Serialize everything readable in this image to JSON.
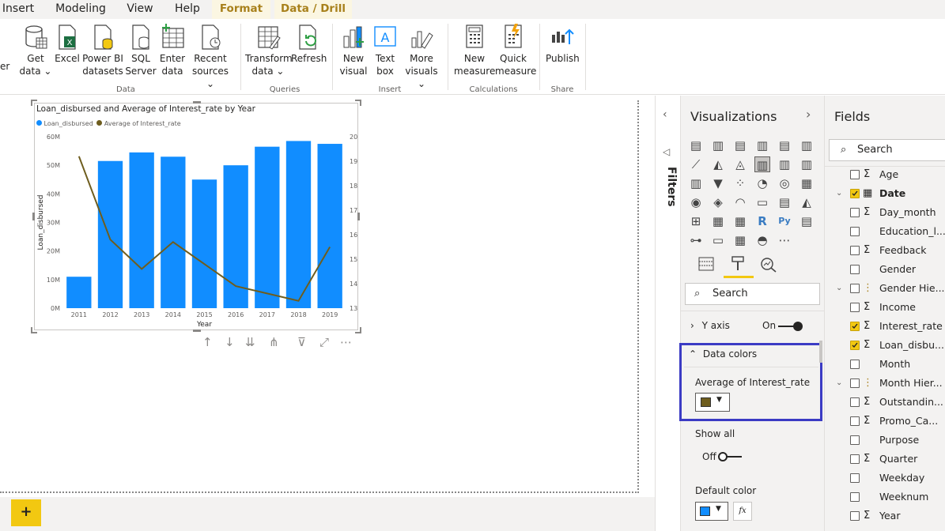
{
  "tabs": [
    "Insert",
    "Modeling",
    "View",
    "Help",
    "Format",
    "Data / Drill"
  ],
  "ribbon": {
    "data_group": {
      "label": "Data",
      "buttons": [
        "Get data",
        "Excel",
        "Power BI datasets",
        "SQL Server",
        "Enter data",
        "Recent sources"
      ]
    },
    "queries_group": {
      "label": "Queries",
      "buttons": [
        "Transform data",
        "Refresh"
      ]
    },
    "insert_group": {
      "label": "Insert",
      "buttons": [
        "New visual",
        "Text box",
        "More visuals"
      ]
    },
    "calc_group": {
      "label": "Calculations",
      "buttons": [
        "New measure",
        "Quick measure"
      ]
    },
    "share_group": {
      "label": "Share",
      "buttons": [
        "Publish"
      ]
    },
    "left_stub": "er"
  },
  "visual": {
    "title": "Loan_disbursed and Average of Interest_rate by Year"
  },
  "chart_data": {
    "type": "bar",
    "title": "Loan_disbursed and Average of Interest_rate by Year",
    "categories": [
      "2011",
      "2012",
      "2013",
      "2014",
      "2015",
      "2016",
      "2017",
      "2018",
      "2019"
    ],
    "series": [
      {
        "name": "Loan_disbursed",
        "kind": "bar",
        "color": "#118dff",
        "values": [
          11000000,
          51500000,
          54500000,
          53000000,
          45000000,
          50000000,
          56500000,
          58500000,
          57500000
        ]
      },
      {
        "name": "Average of Interest_rate",
        "kind": "line",
        "color": "#6e5d1e",
        "axis": "right",
        "values": [
          19.2,
          15.8,
          14.6,
          15.7,
          14.8,
          13.9,
          13.6,
          13.3,
          15.5
        ]
      }
    ],
    "xlabel": "Year",
    "ylabel": "Loan_disbursed",
    "ylim": [
      0,
      60000000
    ],
    "yticks": [
      "0M",
      "10M",
      "20M",
      "30M",
      "40M",
      "50M",
      "60M"
    ],
    "y2lim": [
      13,
      20
    ],
    "y2ticks": [
      "13",
      "14",
      "15",
      "16",
      "17",
      "18",
      "19",
      "20"
    ],
    "legend": "top-left"
  },
  "filters": {
    "label": "Filters"
  },
  "viz_pane": {
    "title": "Visualizations",
    "search_placeholder": "Search",
    "y_axis": {
      "label": "Y axis",
      "state": "On"
    },
    "data_colors": {
      "label": "Data colors",
      "series_label": "Average of Interest_rate",
      "series_color": "#6e5d1e"
    },
    "show_all": {
      "label": "Show all",
      "state": "Off"
    },
    "default_color": {
      "label": "Default color",
      "color": "#118dff",
      "fx": "fx"
    }
  },
  "fields_pane": {
    "title": "Fields",
    "search_placeholder": "Search",
    "items": [
      {
        "name": "Age",
        "sigma": true,
        "checked": false,
        "expand": false
      },
      {
        "name": "Date",
        "sigma": false,
        "checked": true,
        "expand": true,
        "calendar": true
      },
      {
        "name": "Day_month",
        "sigma": true,
        "checked": false,
        "expand": false
      },
      {
        "name": "Education_l...",
        "sigma": false,
        "checked": false,
        "expand": false
      },
      {
        "name": "Feedback",
        "sigma": true,
        "checked": false,
        "expand": false
      },
      {
        "name": "Gender",
        "sigma": false,
        "checked": false,
        "expand": false
      },
      {
        "name": "Gender Hie...",
        "sigma": false,
        "checked": false,
        "expand": true,
        "hier": true
      },
      {
        "name": "Income",
        "sigma": true,
        "checked": false,
        "expand": false
      },
      {
        "name": "Interest_rate",
        "sigma": true,
        "checked": true,
        "expand": false
      },
      {
        "name": "Loan_disbu...",
        "sigma": true,
        "checked": true,
        "expand": false
      },
      {
        "name": "Month",
        "sigma": false,
        "checked": false,
        "expand": false
      },
      {
        "name": "Month Hier...",
        "sigma": false,
        "checked": false,
        "expand": true,
        "hier": true
      },
      {
        "name": "Outstandin...",
        "sigma": true,
        "checked": false,
        "expand": false
      },
      {
        "name": "Promo_Ca...",
        "sigma": true,
        "checked": false,
        "expand": false
      },
      {
        "name": "Purpose",
        "sigma": false,
        "checked": false,
        "expand": false
      },
      {
        "name": "Quarter",
        "sigma": true,
        "checked": false,
        "expand": false
      },
      {
        "name": "Weekday",
        "sigma": false,
        "checked": false,
        "expand": false
      },
      {
        "name": "Weeknum",
        "sigma": false,
        "checked": false,
        "expand": false
      },
      {
        "name": "Year",
        "sigma": true,
        "checked": false,
        "expand": false
      }
    ]
  },
  "colors": {
    "accent": "#f2c811",
    "highlight_border": "#3b3bc4",
    "bar": "#118dff",
    "line": "#6e5d1e"
  }
}
